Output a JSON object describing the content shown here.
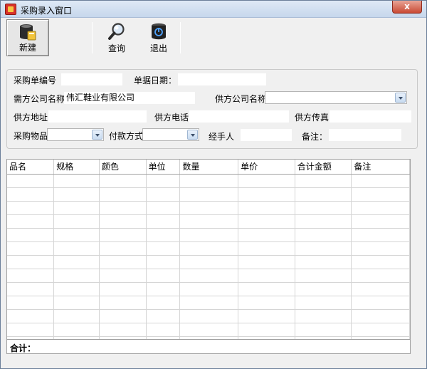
{
  "window": {
    "title": "采购录入窗口",
    "close_glyph": "x"
  },
  "toolbar": {
    "new_label": "新建",
    "search_label": "查询",
    "exit_label": "退出",
    "new_icon": "database-icon",
    "search_icon": "magnifier-icon",
    "exit_icon": "power-icon"
  },
  "form": {
    "order_no_label": "采购单编号",
    "order_no_value": "",
    "doc_date_label": "单据日期：",
    "doc_date_value": "",
    "buyer_company_label": "需方公司名称",
    "buyer_company_value": "伟汇鞋业有限公司",
    "supplier_company_label": "供方公司名称",
    "supplier_company_value": "",
    "supplier_address_label": "供方地址",
    "supplier_address_value": "",
    "supplier_phone_label": "供方电话",
    "supplier_phone_value": "",
    "supplier_fax_label": "供方传真",
    "supplier_fax_value": "",
    "purchase_item_label": "采购物品",
    "purchase_item_value": "",
    "payment_method_label": "付款方式",
    "payment_method_value": "",
    "handler_label": "经手人",
    "handler_value": "",
    "remark_label": "备注：",
    "remark_value": ""
  },
  "grid": {
    "columns": [
      "品名",
      "规格",
      "颜色",
      "单位",
      "数量",
      "单价",
      "合计金额",
      "备注"
    ],
    "row_count": 13
  },
  "totals": {
    "label": "合计："
  }
}
